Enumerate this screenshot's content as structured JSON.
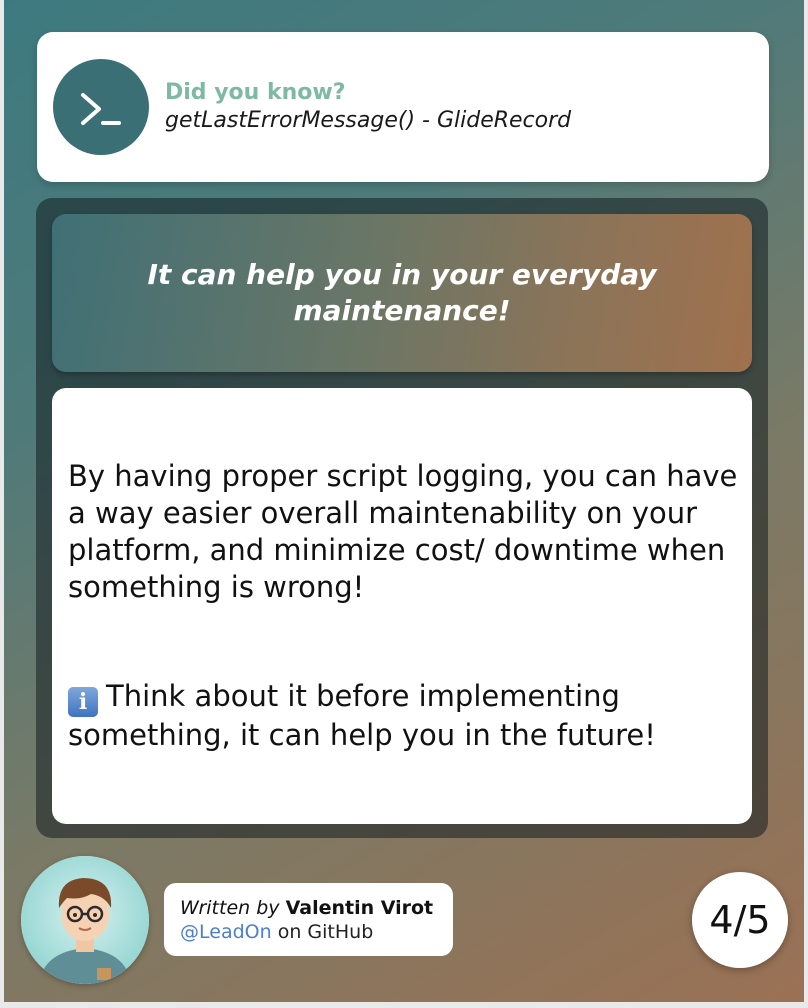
{
  "header": {
    "label": "Did you know?",
    "function_name": "getLastErrorMessage() - GlideRecord",
    "icon": "terminal-icon"
  },
  "banner": {
    "text": "It can help you in your everyday maintenance!"
  },
  "content": {
    "paragraph1": "By having proper script logging, you can have a way easier overall maintenability on your platform, and minimize cost/ downtime when something is wrong!",
    "paragraph2": "Think about it before implementing something, it can help you in the future!",
    "info_icon": "info-icon"
  },
  "author": {
    "written_by": "Written by",
    "name": "Valentin Virot",
    "handle": "@LeadOn",
    "platform": "on GitHub"
  },
  "page_counter": "4/5",
  "colors": {
    "accent": "#7ebaa3",
    "terminal_bg": "#3a6f76",
    "link": "#4a7fd0"
  }
}
